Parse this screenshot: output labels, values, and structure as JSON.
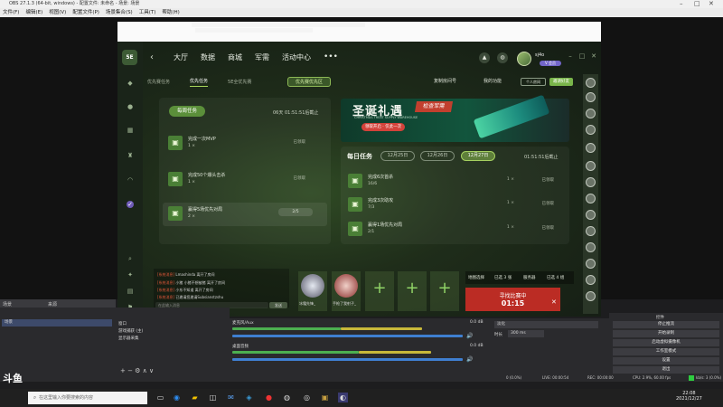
{
  "obs": {
    "title": "OBS 27.1.3 (64-bit, windows) - 配置文件: 未命名 - 场景: 场景",
    "menu": [
      "文件(F)",
      "编辑(E)",
      "视图(V)",
      "配置文件(P)",
      "场景集合(S)",
      "工具(T)",
      "帮助(H)"
    ],
    "docks": {
      "scenes": "场景",
      "sources": "来源",
      "mixer_l": "桌面音频",
      "mixer_r": "麦克风/Aux",
      "transitions": "转场特效",
      "controls": "控件"
    },
    "scene_selected": "场景",
    "sources": [
      "窗口",
      "游戏捕获 (主)",
      "显示器采集"
    ],
    "mixer": [
      {
        "name": "麦克风/Aux",
        "db": "0.0 dB"
      },
      {
        "name": "桌面音频",
        "db": "0.0 dB"
      }
    ],
    "transition": {
      "type": "淡化",
      "duration_label": "时长",
      "duration": "300 ms"
    },
    "controls": [
      "停止推流",
      "开始录制",
      "启动虚拟摄像机",
      "工作室模式",
      "设置",
      "退出"
    ],
    "status": {
      "live": "LIVE: 00:00:54",
      "rec": "REC: 00:00:00",
      "cpu": "CPU: 2.9%, 60.00 fps",
      "drop": "0 (0.0%)",
      "kb": "kb/s: 3 (0.0%)"
    }
  },
  "game": {
    "nav": [
      "大厅",
      "数据",
      "商城",
      "军需",
      "活动中心"
    ],
    "more": "•••",
    "user": {
      "name": "sj4o",
      "badge": "V 会员"
    },
    "subtabs": [
      "优先赛任务",
      "优先任务",
      "5E全优先赛"
    ],
    "prio_zone": "优先赛优先区",
    "actions": {
      "copy_room": "复制房间号",
      "my_func": "我的功能",
      "mini": "个人房间",
      "open_room": "邀请好友"
    },
    "weekly": {
      "tag": "每周任务",
      "deadline": "06天 01:51:51后截止",
      "tasks": [
        {
          "title": "完成一次MVP",
          "reward": "1 ×",
          "status": "已领取"
        },
        {
          "title": "完成50个爆头击杀",
          "reward": "1 ×",
          "status": "已领取"
        },
        {
          "title": "赢得5场优先对局",
          "reward": "2 ×",
          "progress": "2/5"
        }
      ]
    },
    "banner": {
      "title": "圣诞礼遇",
      "badge": "检查军需",
      "sub": "CHRISTMAS TREAT SUPPLY WAREHOUSE",
      "btn": "领取开启 · 仅此一次"
    },
    "daily": {
      "title": "每日任务",
      "dates": [
        "12月25日",
        "12月26日",
        "12月27日"
      ],
      "deadline": "01:51:51后截止",
      "tasks": [
        {
          "title": "完成6次首杀",
          "sub": "16/6",
          "reward": "1 ×",
          "status": "已领取"
        },
        {
          "title": "完成3次助攻",
          "sub": "7/3",
          "reward": "1 ×",
          "status": "已领取"
        },
        {
          "title": "赢得1场优先对局",
          "sub": "2/1",
          "reward": "1 ×",
          "status": "已领取"
        }
      ]
    },
    "chat": [
      {
        "name": "[系统消息]",
        "text": "Lmashinda 离开了房间"
      },
      {
        "name": "[系统消息]",
        "text": "小猪 小猪不想被猪 离开了房间"
      },
      {
        "name": "[系统消息]",
        "text": "小东不知道 离开了房间"
      },
      {
        "name": "[系统消息]",
        "text": "已邀请您邀请Subsianstzshu"
      }
    ],
    "chat_placeholder": "在此输入消息",
    "send": "发送",
    "players": [
      {
        "name": "冰霜先锋_"
      },
      {
        "name": "手枪了我射子_"
      }
    ],
    "mode": {
      "map_label": "地图选择",
      "map_value": "已选 3 张",
      "server_label": "服务器",
      "server_value": "已选 4 组"
    },
    "match": {
      "label": "寻找比赛中",
      "time": "01:15"
    }
  },
  "taskbar": {
    "search_placeholder": "在这里输入你要搜索的内容",
    "time": "22:08",
    "date": "2021/12/27",
    "watermark": "斗鱼"
  },
  "colors": {
    "accent": "#a6d45b",
    "match_red": "#bb2c24",
    "obs_bg": "#2a2a2d"
  }
}
